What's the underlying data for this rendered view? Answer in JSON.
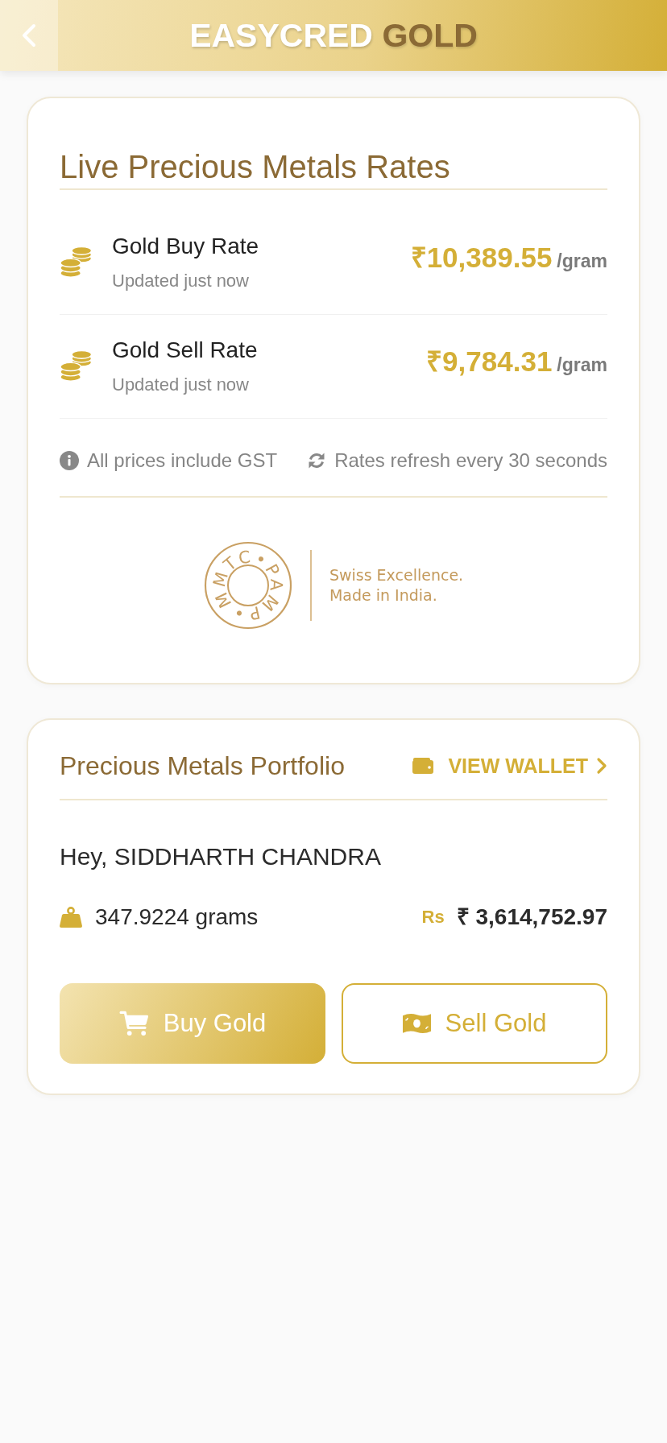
{
  "header": {
    "title": "EASYCRED",
    "title_accent": "GOLD"
  },
  "rates_card": {
    "title": "Live Precious Metals Rates",
    "rates": [
      {
        "name": "Gold Buy Rate",
        "status": "Updated just now",
        "price": "₹10,389.55",
        "unit": "/gram"
      },
      {
        "name": "Gold Sell Rate",
        "status": "Updated just now",
        "price": "₹9,784.31",
        "unit": "/gram"
      }
    ],
    "notes": [
      {
        "kind": "info",
        "text": "All prices include GST"
      },
      {
        "kind": "refresh",
        "text": "Rates refresh every 30 seconds"
      }
    ],
    "partner": {
      "seal_text": "MMTC•PAMP•",
      "tagline": [
        "Swiss Excellence.",
        "Made in India."
      ]
    }
  },
  "portfolio_card": {
    "title": "Precious Metals Portfolio",
    "wallet_link": "VIEW WALLET",
    "greeting": "Hey, SIDDHARTH CHANDRA",
    "holdings": "347.9224 grams",
    "currency_symbol": "Rs",
    "value": "₹ 3,614,752.97",
    "actions": [
      {
        "kind": "buy",
        "label": "Buy Gold"
      },
      {
        "kind": "sell",
        "label": "Sell Gold"
      }
    ]
  }
}
